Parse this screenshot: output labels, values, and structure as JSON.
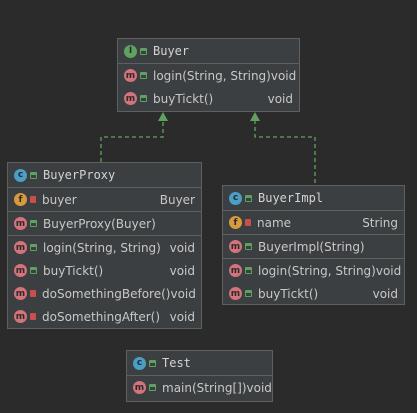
{
  "buyer": {
    "name": "Buyer",
    "kind_icon": "interface-icon",
    "methods": [
      {
        "name": "login(String, String)",
        "type": "void"
      },
      {
        "name": "buyTickt()",
        "type": "void"
      }
    ]
  },
  "buyer_proxy": {
    "name": "BuyerProxy",
    "kind_icon": "class-icon",
    "fields": [
      {
        "name": "buyer",
        "type": "Buyer",
        "visibility": "private"
      }
    ],
    "constructors": [
      {
        "name": "BuyerProxy(Buyer)",
        "type": ""
      }
    ],
    "methods": [
      {
        "name": "login(String, String)",
        "type": "void",
        "visibility": "public"
      },
      {
        "name": "buyTickt()",
        "type": "void",
        "visibility": "public"
      },
      {
        "name": "doSomethingBefore()",
        "type": "void",
        "visibility": "private"
      },
      {
        "name": "doSomethingAfter()",
        "type": "void",
        "visibility": "private"
      }
    ]
  },
  "buyer_impl": {
    "name": "BuyerImpl",
    "kind_icon": "class-icon",
    "fields": [
      {
        "name": "name",
        "type": "String",
        "visibility": "private"
      }
    ],
    "constructors": [
      {
        "name": "BuyerImpl(String)",
        "type": ""
      }
    ],
    "methods": [
      {
        "name": "login(String, String)",
        "type": "void"
      },
      {
        "name": "buyTickt()",
        "type": "void"
      }
    ]
  },
  "test": {
    "name": "Test",
    "kind_icon": "class-icon",
    "methods": [
      {
        "name": "main(String[])",
        "type": "void"
      }
    ]
  },
  "colors": {
    "background": "#2b2b2b",
    "box": "#3c3f41",
    "arrow": "#5fa25f"
  }
}
